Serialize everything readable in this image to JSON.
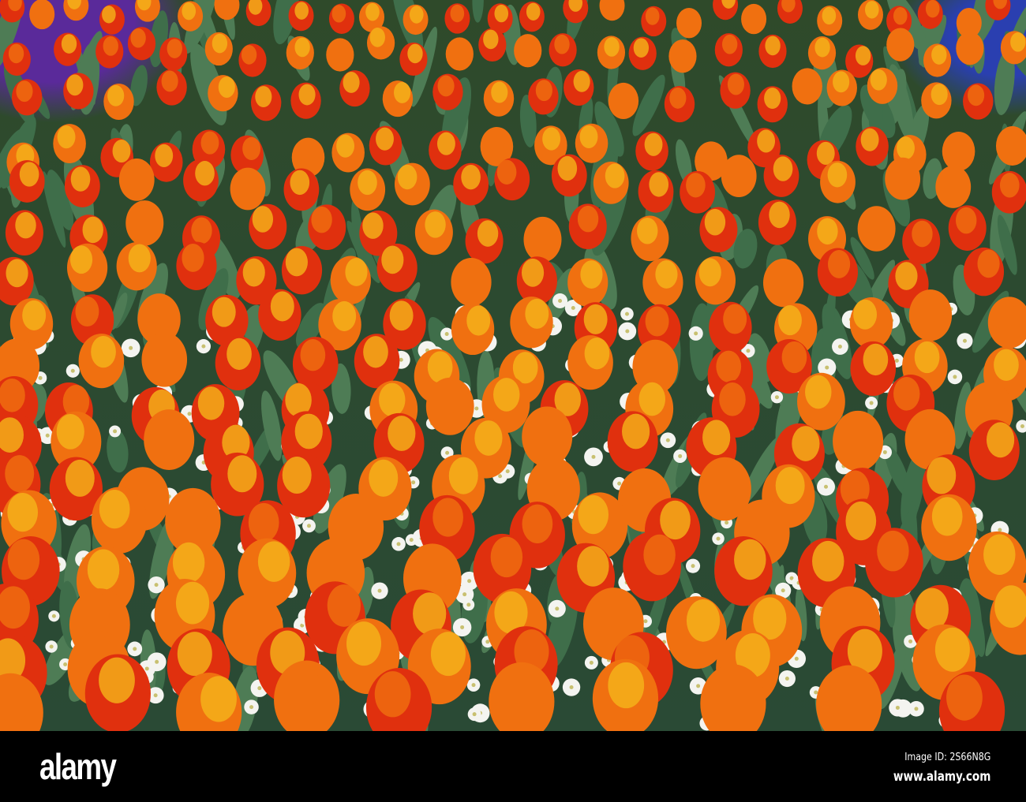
{
  "photo": {
    "subject": "tulip-bed",
    "colors": {
      "tulip_red": "#e0300e",
      "tulip_orange": "#f07010",
      "tulip_yellow": "#f5b51a",
      "anemone_white": "#f4f4f0",
      "leaf_green": "#3c6a45",
      "hyacinth_purple": "#5a2a9a",
      "muscari_blue": "#2a3fb0"
    }
  },
  "footer": {
    "logo": "alamy",
    "image_id": "Image ID: 2S66N8G",
    "website": "www.alamy.com"
  }
}
